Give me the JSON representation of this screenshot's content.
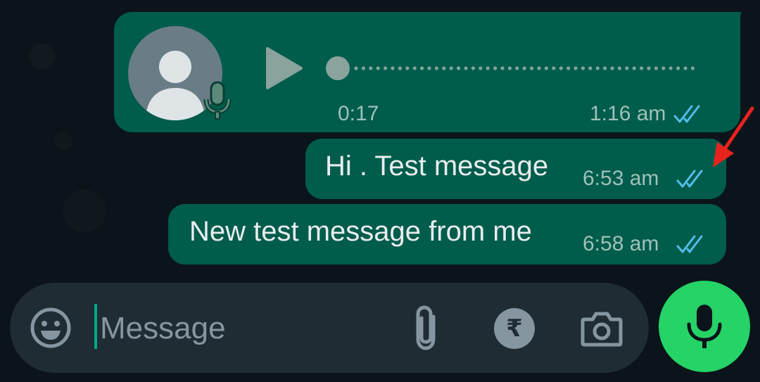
{
  "voice_message": {
    "duration": "0:17",
    "time": "1:16 am",
    "status": "read"
  },
  "messages": [
    {
      "text": "Hi . Test message",
      "time": "6:53 am",
      "status": "read"
    },
    {
      "text": "New test message from me",
      "time": "6:58 am",
      "status": "read"
    }
  ],
  "input": {
    "placeholder": "Message",
    "value": ""
  },
  "icons": {
    "emoji": "emoji-icon",
    "attach": "paperclip-icon",
    "payment": "rupee-icon",
    "payment_symbol": "₹",
    "camera": "camera-icon",
    "send": "microphone-icon"
  },
  "colors": {
    "background": "#0b141a",
    "bubble_outgoing": "#005c4b",
    "read_tick": "#53bdeb",
    "input_bar": "#1f2c34",
    "mic_button": "#25d366",
    "annotation_arrow": "#e8231e"
  }
}
